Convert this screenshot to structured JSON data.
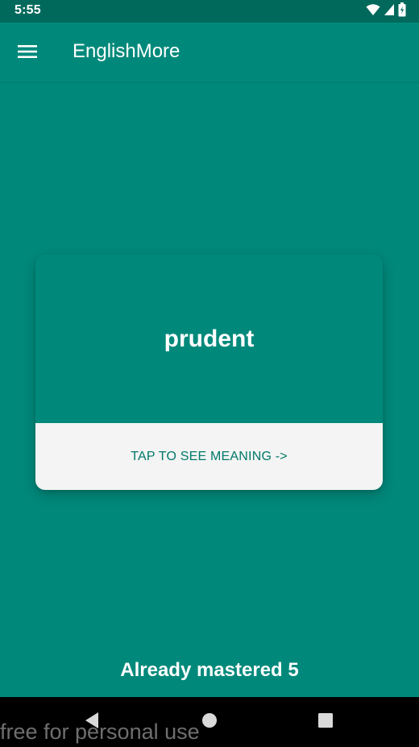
{
  "status_bar": {
    "time": "5:55",
    "icons": [
      "wifi-icon",
      "signal-icon",
      "battery-icon"
    ]
  },
  "app_bar": {
    "title": "EnglishMore",
    "menu_icon": "hamburger-menu-icon"
  },
  "card": {
    "word": "prudent",
    "cta_label": "TAP TO SEE MEANING ->"
  },
  "footer": {
    "mastered_text": "Already mastered 5"
  },
  "nav_bar": {
    "icons": [
      "back-icon",
      "home-icon",
      "recents-icon"
    ]
  },
  "watermark": {
    "text": "free for personal use"
  },
  "colors": {
    "primary": "#00897B",
    "primary_dark": "#00695C",
    "card_bottom": "#F3F4F3",
    "cta_text": "#00796B"
  }
}
